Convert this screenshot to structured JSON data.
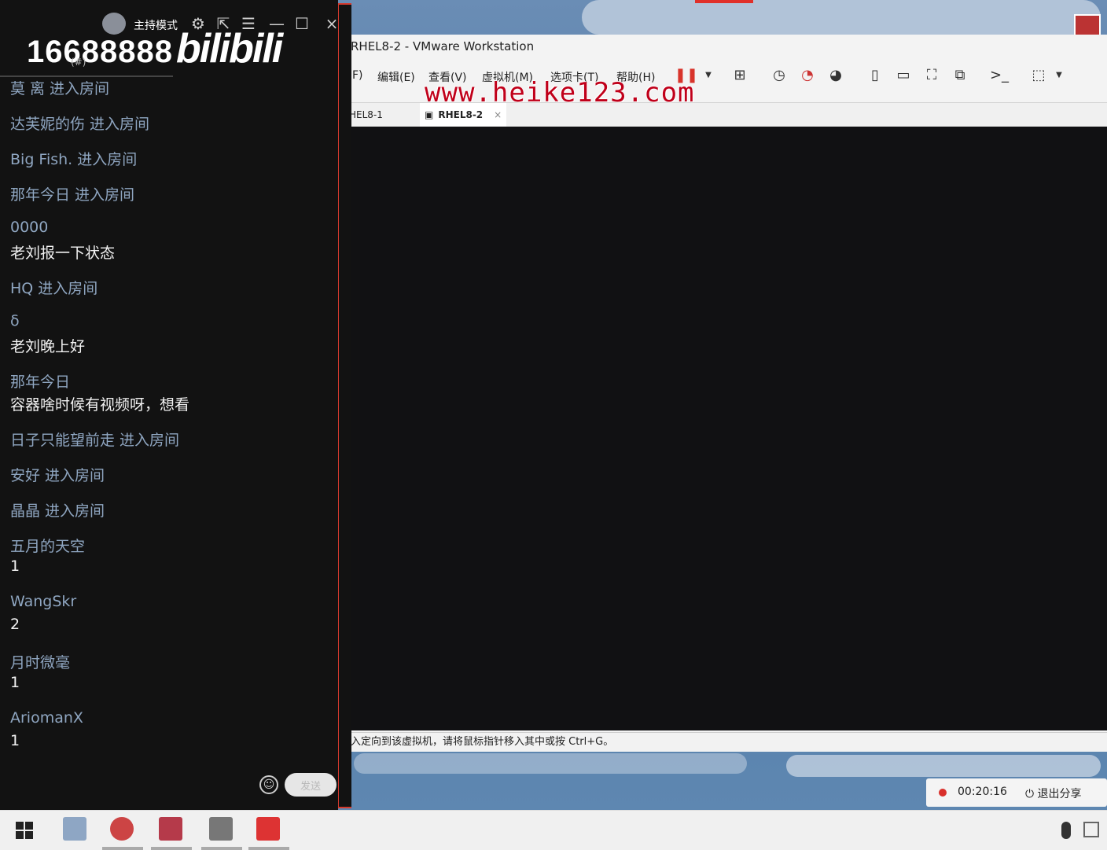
{
  "colors": {
    "panel_bg": "#121212",
    "user_text": "#8fa6c1",
    "message_text": "#f2f2f2",
    "watermark": "#c0001a",
    "panel_border": "#d43a2e",
    "rec_dot": "#d9302b"
  },
  "panel": {
    "host_mode": "主持模式",
    "room_id": "16688888",
    "logo": "bilibili",
    "sub_label": "(#)",
    "icons": [
      "settings-icon",
      "popout-icon",
      "list-icon",
      "minimize-icon",
      "maximize-icon",
      "close-icon"
    ],
    "messages": [
      {
        "user": "莫 离",
        "action": "进入房间"
      },
      {
        "user": "达芙妮的伤",
        "action": "进入房间"
      },
      {
        "user": "Big Fish.",
        "action": "进入房间"
      },
      {
        "user": "那年今日",
        "action": "进入房间"
      },
      {
        "user": "0000",
        "content": "老刘报一下状态"
      },
      {
        "user": "HQ",
        "action": "进入房间"
      },
      {
        "user": "δ",
        "content": "老刘晚上好"
      },
      {
        "user": "那年今日",
        "content": "容器啥时候有视频呀，想看"
      },
      {
        "user": "日子只能望前走",
        "action": "进入房间"
      },
      {
        "user": "安好",
        "action": "进入房间"
      },
      {
        "user": "晶晶",
        "action": "进入房间"
      },
      {
        "user": "五月的天空",
        "content": "1"
      },
      {
        "user": "WangSkr",
        "content": "2"
      },
      {
        "user": "月时微毫",
        "content": "1"
      },
      {
        "user": "AriomanX",
        "content": "1"
      }
    ],
    "send_label": "发送"
  },
  "vmware": {
    "title": "RHEL8-2 - VMware Workstation",
    "menu": [
      "F)",
      "编辑(E)",
      "查看(V)",
      "虚拟机(M)",
      "选项卡(T)",
      "帮助(H)"
    ],
    "tabs": [
      "HEL8-1",
      "RHEL8-2"
    ],
    "status": "入定向到该虚拟机，请将鼠标指针移入其中或按 Ctrl+G。"
  },
  "watermark": "www.heike123.com",
  "recording": {
    "time": "00:20:16",
    "exit_label": "退出分享"
  }
}
